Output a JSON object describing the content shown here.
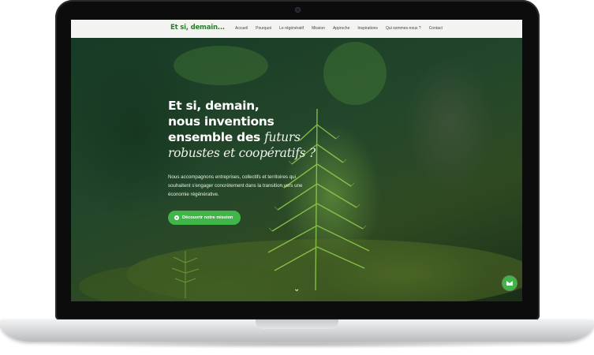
{
  "site": {
    "logo": "Et si, demain..."
  },
  "nav": {
    "items": [
      "Accueil",
      "Pourquoi",
      "Le régénératif",
      "Mission",
      "Approche",
      "Inspirations",
      "Qui sommes-nous ?",
      "Contact"
    ]
  },
  "hero": {
    "title_line1": "Et si, demain,",
    "title_line2": "nous inventions",
    "title_line3_prefix": "ensemble des",
    "title_line3_italic": "futurs",
    "title_line4_italic": "robustes et coopératifs ?",
    "description": "Nous accompagnons entreprises, collectifs et territoires qui souhaitent s'engager concrètement dans la transition vers une économie régénérative.",
    "cta_label": "Découvrir notre mission"
  },
  "icons": {
    "cta": "play-icon",
    "scroll": "chevron-down-icon",
    "contact": "mail-icon"
  },
  "colors": {
    "accent": "#3fb54a",
    "logo": "#2f7a2f",
    "nav_bg": "#f3f4f2"
  }
}
